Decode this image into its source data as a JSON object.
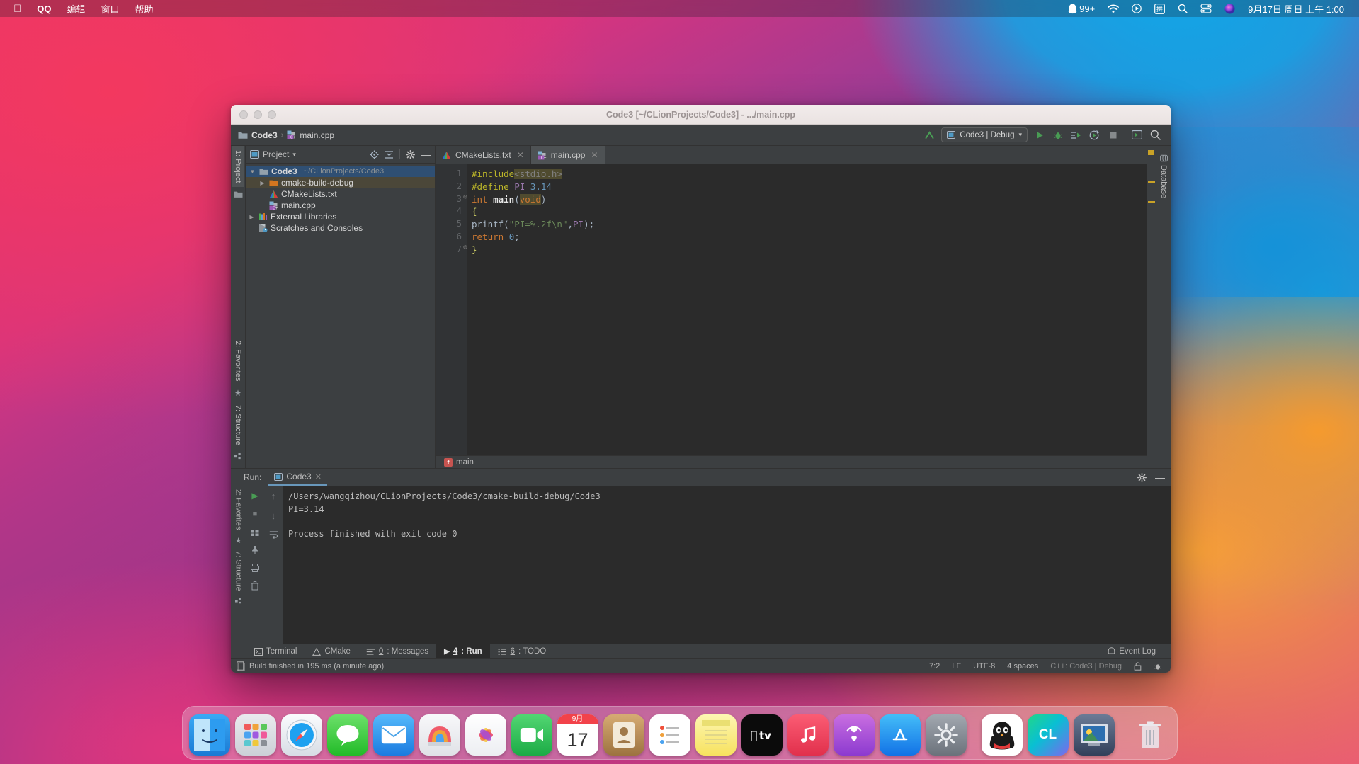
{
  "menubar": {
    "apple_icon": "apple-logo",
    "items": [
      {
        "label": "QQ",
        "bold": true
      },
      {
        "label": "编辑",
        "bold": false
      },
      {
        "label": "窗口",
        "bold": false
      },
      {
        "label": "帮助",
        "bold": false
      }
    ],
    "status_items": [
      {
        "name": "qq-badge",
        "icon": "penguin-icon",
        "label": "99+"
      },
      {
        "name": "wifi",
        "icon": "wifi-icon",
        "label": ""
      },
      {
        "name": "control-center-media",
        "icon": "play-circle-icon",
        "label": ""
      },
      {
        "name": "input-method",
        "icon": "pinyin-icon",
        "label": "拼"
      },
      {
        "name": "spotlight",
        "icon": "search-icon",
        "label": ""
      },
      {
        "name": "control-center",
        "icon": "control-center-icon",
        "label": ""
      },
      {
        "name": "siri",
        "icon": "siri-icon",
        "label": ""
      }
    ],
    "clock": "9月17日 周日 上午 1:00"
  },
  "window": {
    "title": "Code3 [~/CLionProjects/Code3] - .../main.cpp"
  },
  "toolbar": {
    "breadcrumb": [
      "Code3",
      "main.cpp"
    ],
    "separator": "›",
    "run_config": "Code3 | Debug",
    "buttons": [
      "build-icon",
      "run-icon",
      "debug-icon",
      "run-with-coverage-icon",
      "profile-icon",
      "stop-icon",
      "terminal-icon",
      "search-everywhere-icon"
    ]
  },
  "left_rail": {
    "top": [
      {
        "label": "1: Project",
        "active": true
      }
    ],
    "icons": [
      "folder-icon"
    ],
    "bottom": [
      {
        "label": "2: Favorites"
      },
      {
        "label": "7: Structure"
      }
    ]
  },
  "project_panel": {
    "title": "Project",
    "dropdown": "▾",
    "actions": [
      "locate-icon",
      "collapse-all-icon",
      "settings-icon",
      "hide-icon"
    ],
    "tree": [
      {
        "level": 0,
        "arrow": "▼",
        "icon": "folder-icon",
        "label": "Code3",
        "path": "~/CLionProjects/Code3",
        "state": "selected",
        "bold": true
      },
      {
        "level": 1,
        "arrow": "▶",
        "icon": "folder-orange-icon",
        "label": "cmake-build-debug",
        "path": "",
        "state": "highlight",
        "bold": false
      },
      {
        "level": 1,
        "arrow": "",
        "icon": "cmake-icon",
        "label": "CMakeLists.txt",
        "path": "",
        "state": "",
        "bold": false
      },
      {
        "level": 1,
        "arrow": "",
        "icon": "cpp-icon",
        "label": "main.cpp",
        "path": "",
        "state": "",
        "bold": false
      },
      {
        "level": 0,
        "arrow": "▶",
        "icon": "libraries-icon",
        "label": "External Libraries",
        "path": "",
        "state": "",
        "bold": false
      },
      {
        "level": 0,
        "arrow": "",
        "icon": "scratches-icon",
        "label": "Scratches and Consoles",
        "path": "",
        "state": "",
        "bold": false
      }
    ]
  },
  "editor": {
    "tabs": [
      {
        "label": "CMakeLists.txt",
        "icon": "cmake-icon",
        "active": false
      },
      {
        "label": "main.cpp",
        "icon": "cpp-icon",
        "active": true
      }
    ],
    "line_numbers": [
      "1",
      "2",
      "3",
      "4",
      "5",
      "6",
      "7"
    ],
    "lines": [
      "#include<stdio.h>",
      "#define PI 3.14",
      "int main(void)",
      "{",
      "printf(\"PI=%.2f\\n\",PI);",
      "return 0;",
      "}"
    ],
    "breadcrumb_symbol": "main",
    "breadcrumb_icon": "function-marker-icon"
  },
  "right_rail": {
    "items": [
      {
        "label": "Database",
        "icon": "database-icon"
      }
    ]
  },
  "run_window": {
    "label": "Run:",
    "tab": "Code3",
    "tab_icon": "run-config-icon",
    "close_icon": "close-icon",
    "header_actions": [
      "settings-icon",
      "hide-icon"
    ],
    "left_actions": [
      "rerun-icon",
      "stop-icon",
      "grid-icon",
      "pin-icon",
      "print-icon",
      "trash-icon"
    ],
    "nav_actions": [
      "up-icon",
      "down-icon",
      "soft-wrap-icon",
      "scroll-to-end-icon"
    ],
    "console": [
      "/Users/wangqizhou/CLionProjects/Code3/cmake-build-debug/Code3",
      "PI=3.14",
      "",
      "Process finished with exit code 0"
    ]
  },
  "tool_bar": {
    "items": [
      {
        "label": "Terminal",
        "icon": "terminal-icon",
        "num": "",
        "active": false
      },
      {
        "label": "CMake",
        "icon": "cmake-icon",
        "num": "",
        "active": false
      },
      {
        "label": ": Messages",
        "icon": "messages-icon",
        "num": "0",
        "active": false
      },
      {
        "label": ": Run",
        "icon": "run-icon",
        "num": "4",
        "active": true
      },
      {
        "label": ": TODO",
        "icon": "todo-icon",
        "num": "6",
        "active": false
      }
    ],
    "event_log": "Event Log",
    "event_log_icon": "bell-icon"
  },
  "status_bar": {
    "message": "Build finished in 195 ms (a minute ago)",
    "message_icon": "build-icon",
    "caret": "7:2",
    "line_sep": "LF",
    "encoding": "UTF-8",
    "indent": "4 spaces",
    "config": "C++: Code3 | Debug",
    "lock_icon": "lock-icon",
    "inspect_icon": "inspections-icon"
  },
  "dock": {
    "items": [
      {
        "name": "finder",
        "glyph": "🙂",
        "bg": "linear-gradient(#35a8f3,#1d7fd6)",
        "running": true
      },
      {
        "name": "launchpad",
        "glyph": "▦",
        "bg": "linear-gradient(#e9eaee,#cfd2d8)",
        "running": false
      },
      {
        "name": "safari",
        "glyph": "🧭",
        "bg": "linear-gradient(#f2f4f8,#d9dee6)",
        "running": false
      },
      {
        "name": "messages",
        "glyph": "💬",
        "bg": "linear-gradient(#6ce06a,#2fc02c)",
        "running": false
      },
      {
        "name": "mail",
        "glyph": "✉",
        "bg": "linear-gradient(#4fb3f7,#1c7fe0)",
        "running": false
      },
      {
        "name": "photos-booth",
        "glyph": "◧",
        "bg": "linear-gradient(#f7f7f9,#e2e4e8)",
        "running": false
      },
      {
        "name": "photos",
        "glyph": "✿",
        "bg": "linear-gradient(#fefefe,#ededf0)",
        "running": false
      },
      {
        "name": "facetime",
        "glyph": "▢",
        "bg": "linear-gradient(#4fd36f,#1fae48)",
        "running": false
      },
      {
        "name": "calendar",
        "glyph": "17",
        "bg": "#ffffff",
        "running": false
      },
      {
        "name": "contacts",
        "glyph": "👤",
        "bg": "linear-gradient(#c79a63,#9d7340)",
        "running": false
      },
      {
        "name": "reminders",
        "glyph": "☰",
        "bg": "#ffffff",
        "running": false
      },
      {
        "name": "notes",
        "glyph": "▤",
        "bg": "linear-gradient(#fdf3a8,#f8e46a)",
        "running": false
      },
      {
        "name": "apple-tv",
        "glyph": "tv",
        "bg": "#0a0a0a",
        "running": false
      },
      {
        "name": "music",
        "glyph": "♪",
        "bg": "linear-gradient(#fb5c74,#e8334f)",
        "running": false
      },
      {
        "name": "podcasts",
        "glyph": "◉",
        "bg": "linear-gradient(#c86dd7,#9a3fd0)",
        "running": false
      },
      {
        "name": "app-store",
        "glyph": "A",
        "bg": "linear-gradient(#38b7f7,#1477e6)",
        "running": false
      },
      {
        "name": "system-preferences",
        "glyph": "⚙",
        "bg": "linear-gradient(#9aa0a8,#6e757e)",
        "running": false
      },
      {
        "name": "qq",
        "glyph": "🐧",
        "bg": "#ffffff",
        "running": true
      },
      {
        "name": "clion",
        "glyph": "CL",
        "bg": "linear-gradient(135deg,#21d789,#0fa0ce)",
        "running": true
      },
      {
        "name": "screenshot-app",
        "glyph": "▣",
        "bg": "linear-gradient(#5a6a86,#2f3b52)",
        "running": true
      },
      {
        "name": "trash",
        "glyph": "🗑",
        "bg": "transparent",
        "running": false
      }
    ],
    "calendar_month": "9月",
    "calendar_day": "17"
  }
}
